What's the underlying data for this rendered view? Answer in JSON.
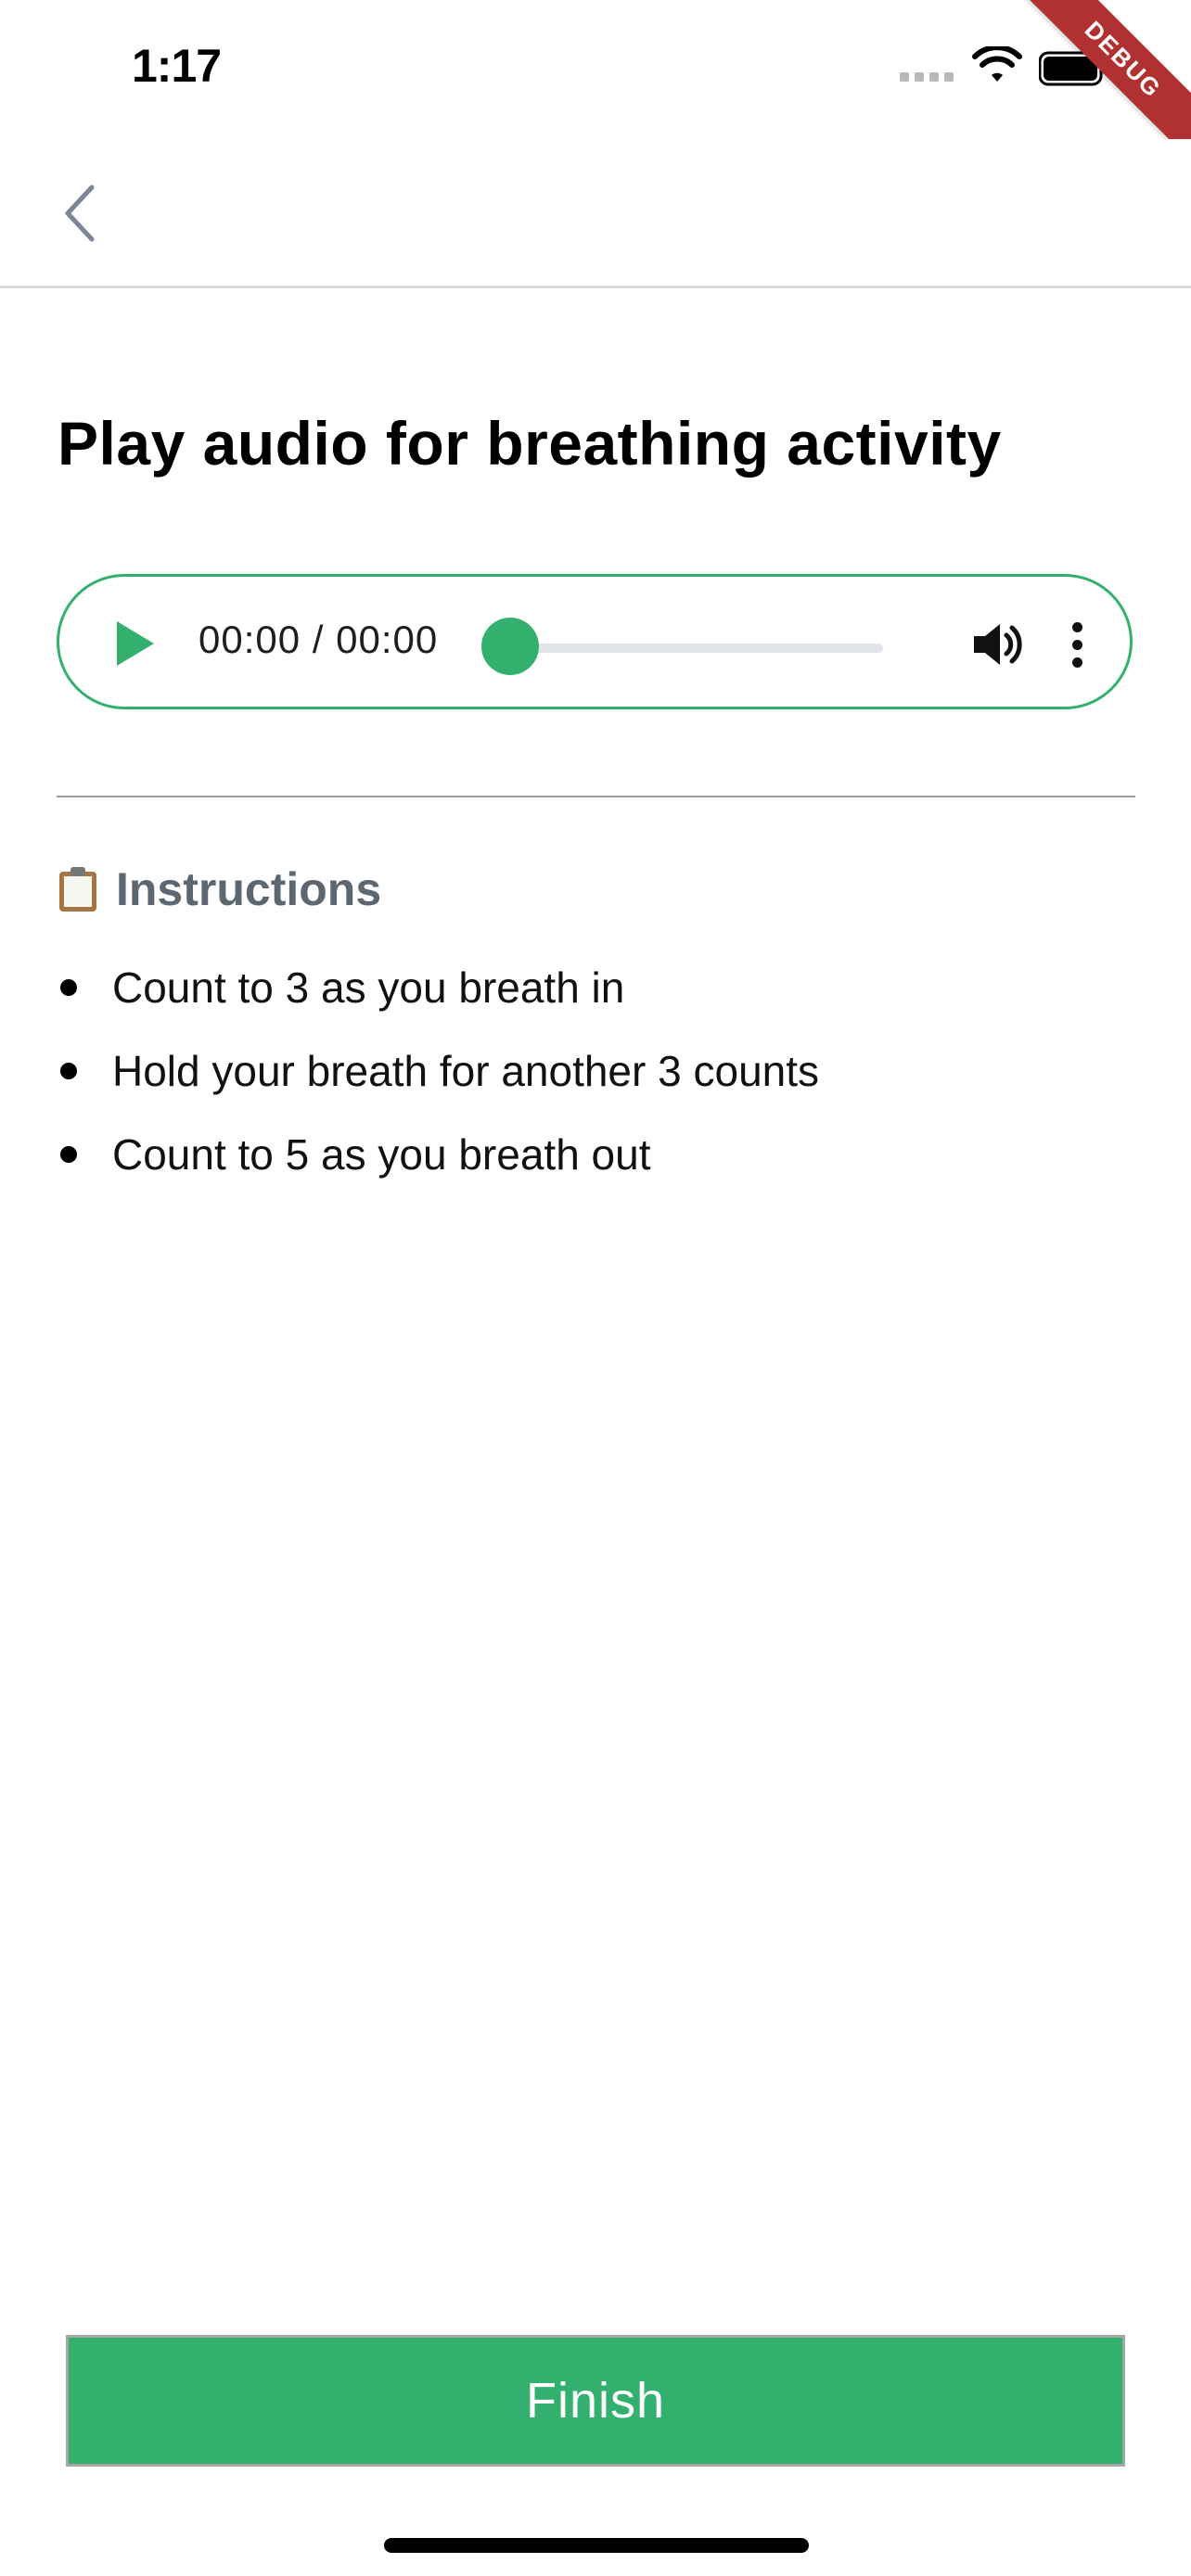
{
  "status_bar": {
    "time": "1:17",
    "debug_label": "DEBUG"
  },
  "app_bar": {
    "back_icon": "chevron-left-icon"
  },
  "page": {
    "title": "Play audio for breathing activity"
  },
  "audio_player": {
    "time_display": "00:00 / 00:00",
    "progress": 0,
    "accent_color": "#33b06d",
    "play_icon": "play-icon",
    "volume_icon": "volume-icon",
    "more_icon": "more-vertical-icon"
  },
  "instructions": {
    "icon": "clipboard-icon",
    "title": "Instructions",
    "items": [
      "Count to 3 as you breath in",
      "Hold your breath for another 3 counts",
      "Count to 5 as you breath out"
    ]
  },
  "footer": {
    "finish_label": "Finish",
    "button_color": "#33b06d"
  }
}
